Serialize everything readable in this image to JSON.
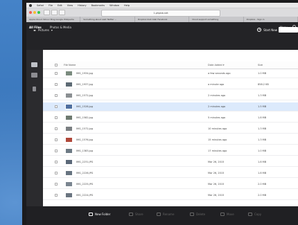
{
  "menubar": {
    "items": [
      "Safari",
      "File",
      "Edit",
      "View",
      "History",
      "Bookmarks",
      "Window",
      "Help"
    ]
  },
  "browser": {
    "address": "1.phpbb.net",
    "tabs": [
      "Apple  iCloud  Yahoo!  Bing  Google  Wikipedia",
      "Something about  wait  Twitter  ...",
      "Dropbox  blah blah  Facebook",
      "Cloud support  something",
      "Dropbox - Sign in"
    ]
  },
  "app": {
    "nav": [
      "All Files",
      "Photos & Media"
    ],
    "account_label": "Menu ▾",
    "breadcrumb": "Pictures",
    "start_button": "Start New",
    "table": {
      "columns": [
        "File Name",
        "Date Added ▾",
        "Size"
      ],
      "rows": [
        {
          "name": "IMG_1934.jpg",
          "date": "a few seconds ago",
          "size": "1.0 MB"
        },
        {
          "name": "IMG_1937.jpg",
          "date": "a minute ago",
          "size": "858.2 KB"
        },
        {
          "name": "IMG_1572.jpg",
          "date": "2 minutes ago",
          "size": "1.3 MB"
        },
        {
          "name": "IMG_1528.jpg",
          "date": "2 minutes ago",
          "size": "1.5 MB",
          "selected": true
        },
        {
          "name": "IMG_1582.jpg",
          "date": "5 minutes ago",
          "size": "1.8 MB"
        },
        {
          "name": "IMG_1572.jpg",
          "date": "10 minutes ago",
          "size": "1.3 MB"
        },
        {
          "name": "IMG_1576.jpg",
          "date": "15 minutes ago",
          "size": "1.3 MB"
        },
        {
          "name": "IMG_1383.jpg",
          "date": "17 minutes ago",
          "size": "1.0 MB"
        },
        {
          "name": "IMG_2231.JPG",
          "date": "Mar 26, 2015",
          "size": "1.8 MB"
        },
        {
          "name": "IMG_2226.JPG",
          "date": "Mar 26, 2015",
          "size": "1.8 MB"
        },
        {
          "name": "IMG_2225.JPG",
          "date": "Mar 26, 2015",
          "size": "2.0 MB"
        },
        {
          "name": "IMG_2224.JPG",
          "date": "Mar 26, 2015",
          "size": "2.0 MB"
        }
      ]
    },
    "footer": [
      "New Folder",
      "Share",
      "Rename",
      "Delete",
      "Move",
      "Copy"
    ]
  }
}
